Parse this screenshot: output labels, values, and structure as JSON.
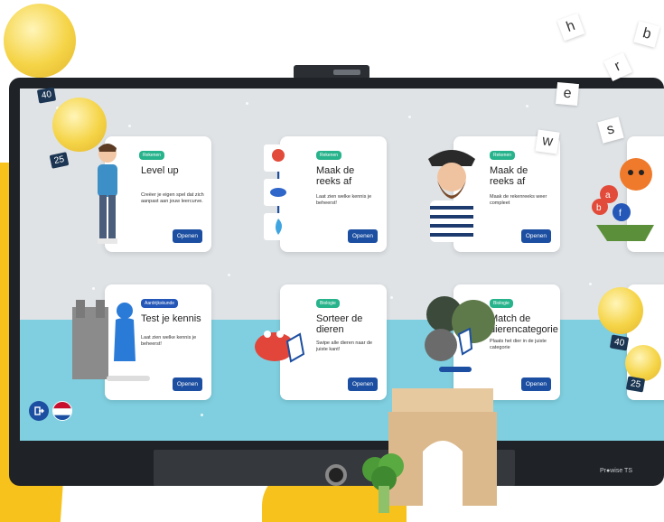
{
  "device": {
    "brand": "Pr●wise TS"
  },
  "cards": [
    {
      "badge": "Rekenen",
      "badge_color": "#27b38b",
      "title": "Level up",
      "description": "Creëer je eigen spel dat zich aanpast aan jouw leercurve.",
      "button": "Openen"
    },
    {
      "badge": "Rekenen",
      "badge_color": "#27b38b",
      "title": "Maak de reeks af",
      "description": "Laat zien welke kennis je beheerst!",
      "button": "Openen"
    },
    {
      "badge": "Rekenen",
      "badge_color": "#27b38b",
      "title": "Maak de reeks af",
      "description": "Maak de rekenreeks weer compleet",
      "button": "Openen"
    },
    {
      "badge": "Aardrijkskunde",
      "badge_color": "#2457b8",
      "title": "Test je kennis",
      "description": "Laat zien welke kennis je beheerst!",
      "button": "Openen"
    },
    {
      "badge": "Biologie",
      "badge_color": "#27b38b",
      "title": "Sorteer de dieren",
      "description": "Swipe alle dieren naar de juiste kant!",
      "button": "Openen"
    },
    {
      "badge": "Biologie",
      "badge_color": "#27b38b",
      "title": "Match de dierencategorie",
      "description": "Plaats het dier in de juiste categorie",
      "button": "Openen"
    }
  ],
  "balloons": [
    {
      "number": "40"
    },
    {
      "number": "25"
    },
    {
      "number": "40"
    },
    {
      "number": "25"
    }
  ],
  "letters": [
    "h",
    "b",
    "r",
    "e",
    "s",
    "w"
  ],
  "letter_tiles_in_card_area": [
    "a",
    "b",
    "f"
  ],
  "icons": {
    "exit": "exit-icon",
    "language": "dutch-flag-icon"
  }
}
